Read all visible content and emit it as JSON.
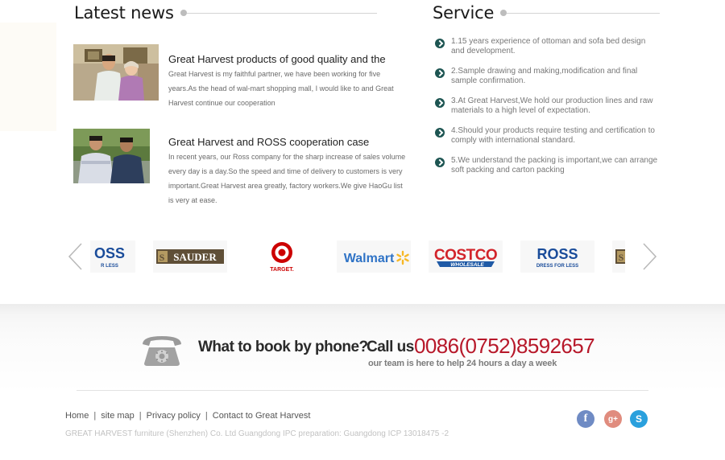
{
  "news": {
    "title": "Latest news",
    "items": [
      {
        "title": "Great Harvest products of good quality and the",
        "desc": "Great Harvest is my faithful partner, we have been working for five years.As the head of wal-mart shopping mall, I would like to and Great Harvest continue our cooperation"
      },
      {
        "title": "Great Harvest and ROSS cooperation case",
        "desc": "In recent years, our Ross company for the sharp increase of sales volume every day is a day.So the speed and time of delivery to customers is very important.Great Harvest area greatly, factory workers.We give HaoGu list is very at ease."
      }
    ]
  },
  "service": {
    "title": "Service",
    "items": [
      "1.15 years experience of ottoman and sofa bed design and development.",
      "2.Sample drawing and making,modification and final sample confirmation.",
      "3.At Great Harvest,We hold our production lines and raw materials to a high level of expectation.",
      "4.Should your products require testing and certification to comply with international standard.",
      "5.We understand the packing is important,we can arrange soft packing and carton packing"
    ]
  },
  "brands": {
    "ross_partial": "OSS",
    "ross_partial_sub": "R LESS",
    "sauder": "SAUDER",
    "target": "TARGET.",
    "walmart": "Walmart",
    "costco": "COSTCO",
    "costco_sub": "WHOLESALE",
    "ross": "ROSS",
    "ross_sub": "DRESS FOR LESS"
  },
  "call": {
    "question": "What to book by phone?",
    "call_us": "Call us",
    "number": "0086(0752)8592657",
    "sub": "our team is here to help 24 hours a day a week"
  },
  "footer": {
    "links": [
      "Home",
      "site map",
      "Privacy policy",
      "Contact to Great Harvest"
    ],
    "separator": "|",
    "copyright": "GREAT HARVEST furniture (Shenzhen) Co. Ltd Guangdong IPC preparation: Guangdong ICP 13018475 -2",
    "social": {
      "facebook": "f",
      "googleplus": "g+",
      "skype": "S"
    }
  },
  "colors": {
    "phone_number": "#b7182a",
    "service_bullet": "#1d5552",
    "facebook": "#6f8bc4",
    "googleplus": "#e08c7e",
    "skype": "#2aa0dd",
    "costco_red": "#d2232a",
    "costco_blue": "#1f5aa6",
    "ross_blue": "#1a4c9a",
    "walmart_blue": "#2f73c6",
    "walmart_yellow": "#f7b826",
    "target_red": "#cc0000",
    "sauder_bg": "#5f4f37"
  }
}
